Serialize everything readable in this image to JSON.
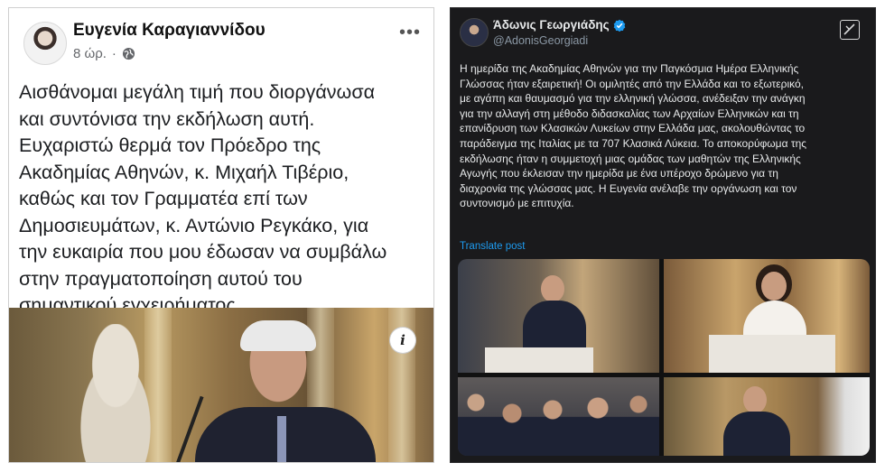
{
  "facebook_post": {
    "author": "Ευγενία Καραγιαννίδου",
    "time": "8 ώρ.",
    "meta_separator": "·",
    "more_label": "•••",
    "text": "Αισθάνομαι μεγάλη τιμή που διοργάνωσα\nκαι συντόνισα την εκδήλωση αυτή.\nΕυχαριστώ θερμά τον Πρόεδρο της\nΑκαδημίας Αθηνών, κ. Μιχαήλ Τιβέριο,\nκαθώς και τον Γραμματέα επί των\nΔημοσιευμάτων, κ. Αντώνιο Ρεγκάκο, για\nτην ευκαιρία που μου έδωσαν να συμβάλω\nστην πραγματοποίηση αυτού του\nσημαντικού εγχειρήματος.",
    "info_icon_glyph": "i"
  },
  "x_post": {
    "author": "Άδωνις Γεωργιάδης",
    "handle": "@AdonisGeorgiadi",
    "text": "Η ημερίδα της Ακαδημίας Αθηνών για την Παγκόσμια Ημέρα Ελληνικής\nΓλώσσας ήταν εξαιρετική! Οι ομιλητές από την Ελλάδα και το εξωτερικό,\nμε αγάπη και θαυμασμό για την ελληνική γλώσσα, ανέδειξαν την ανάγκη\nγια την αλλαγή στη μέθοδο διδασκαλίας των Αρχαίων Ελληνικών και τη\nεπανίδρυση των Κλασικών Λυκείων στην Ελλάδα μας, ακολουθώντας το\nπαράδειγμα της Ιταλίας με τα 707 Κλασικά Λύκεια. Το αποκορύφωμα της\nεκδήλωσης ήταν η συμμετοχή μιας ομάδας των μαθητών της Ελληνικής\nΑγωγής που έκλεισαν την ημερίδα με ένα υπέροχο δρώμενο για τη\nδιαχρονία της γλώσσας μας. Η Ευγενία ανέλαβε την οργάνωση και τον\nσυντονισμό με επιτυχία.",
    "translate_label": "Translate post",
    "verified_color": "#1d9bf0",
    "link_color": "#1d9bf0"
  }
}
